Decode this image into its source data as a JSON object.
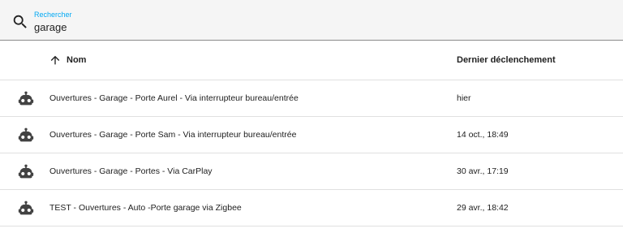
{
  "search": {
    "label": "Rechercher",
    "value": "garage",
    "icon": "search-icon"
  },
  "header": {
    "sort_icon": "arrow-up-icon",
    "col_name": "Nom",
    "col_trigger": "Dernier déclenchement"
  },
  "rows": [
    {
      "icon": "robot-icon",
      "name": "Ouvertures - Garage - Porte Aurel - Via interrupteur bureau/entrée",
      "last_triggered": "hier"
    },
    {
      "icon": "robot-icon",
      "name": "Ouvertures - Garage - Porte Sam - Via interrupteur bureau/entrée",
      "last_triggered": "14 oct., 18:49"
    },
    {
      "icon": "robot-icon",
      "name": "Ouvertures - Garage - Portes - Via CarPlay",
      "last_triggered": "30 avr., 17:19"
    },
    {
      "icon": "robot-icon",
      "name": "TEST - Ouvertures - Auto -Porte garage via Zigbee",
      "last_triggered": "29 avr., 18:42"
    }
  ],
  "colors": {
    "accent": "#03a9f4",
    "icon": "#424242"
  }
}
